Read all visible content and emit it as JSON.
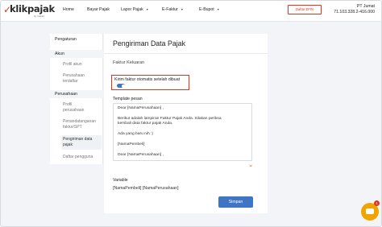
{
  "brand": {
    "logo_text": "klikpajak",
    "logo_sub": "by mekari",
    "accent": "#e2331d",
    "primary": "#3f76c4"
  },
  "nav": {
    "items": [
      {
        "label": "Home",
        "has_caret": false
      },
      {
        "label": "Bayar Pajak",
        "has_caret": false
      },
      {
        "label": "Lapor Pajak",
        "has_caret": true
      },
      {
        "label": "E-Faktur",
        "has_caret": true
      },
      {
        "label": "E-Bupot",
        "has_caret": true
      }
    ],
    "spt_button": "Daftar EFIN",
    "company_name": "PT Jumat",
    "company_npwp": "71.103.328.2-416.000"
  },
  "sidebar": {
    "pengaturan": "Pengaturan",
    "akun": "Akun",
    "profil_akun": "Profil akun",
    "perusahaan_terdaftar": [
      "Perusahaan",
      "terdaftar"
    ],
    "perusahaan": "Perusahaan",
    "profil_perusahaan": [
      "Profil",
      "perusahaan"
    ],
    "penandatanganan": [
      "Penandatanganan",
      "faktur/SPT"
    ],
    "pengiriman": [
      "Pengiriman data",
      "pajak"
    ],
    "daftar_pengguna": "Daftar pengguna"
  },
  "main": {
    "title": "Pengiriman Data Pajak",
    "section": "Faktur Keluaran",
    "auto_send_label": "Kirim faktur otomatis setelah dibuat",
    "auto_send_enabled": true,
    "template_label": "Template pesan",
    "template_lines": [
      "Dear [NamaPerusahaan] ,",
      "",
      "Berikut adalah lampiran Faktur Pajak Anda. Silakan periksa",
      "kembali data faktur pajak Anda.",
      "",
      "Ada yang baru nih :)",
      "",
      "[NamaPembeli]",
      "",
      "Dear [NamaPerusahaan] ,"
    ],
    "variable_label": "Variable",
    "variable_text": "[NamaPembeli] [NamaPerusahaan]",
    "save_label": "Simpan"
  },
  "chat": {
    "badge_count": "1"
  }
}
